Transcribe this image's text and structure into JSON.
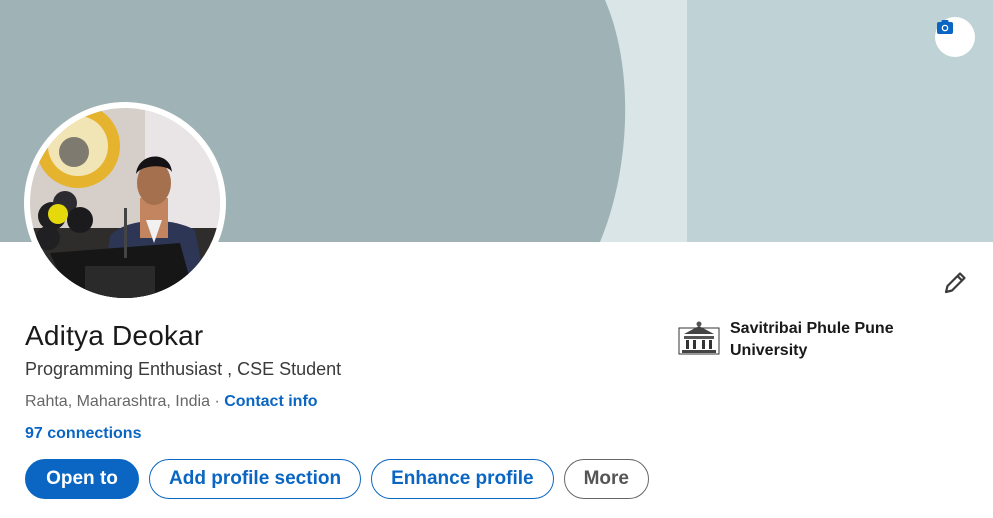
{
  "profile": {
    "name": "Aditya Deokar",
    "headline": "Programming Enthusiast , CSE Student",
    "location": "Rahta, Maharashtra, India",
    "separator": " · ",
    "contact_link": "Contact info",
    "connections": "97 connections"
  },
  "education": {
    "university": "Savitribai Phule Pune University"
  },
  "actions": {
    "open_to": "Open to",
    "add_profile_section": "Add profile section",
    "enhance_profile": "Enhance profile",
    "more": "More"
  },
  "icons": {
    "camera": "camera-icon",
    "edit": "pencil-icon",
    "university_logo": "university-emblem"
  },
  "colors": {
    "accent": "#0a66c2",
    "banner_light": "#bfd2d6",
    "banner_dark": "#9fb2b5"
  }
}
